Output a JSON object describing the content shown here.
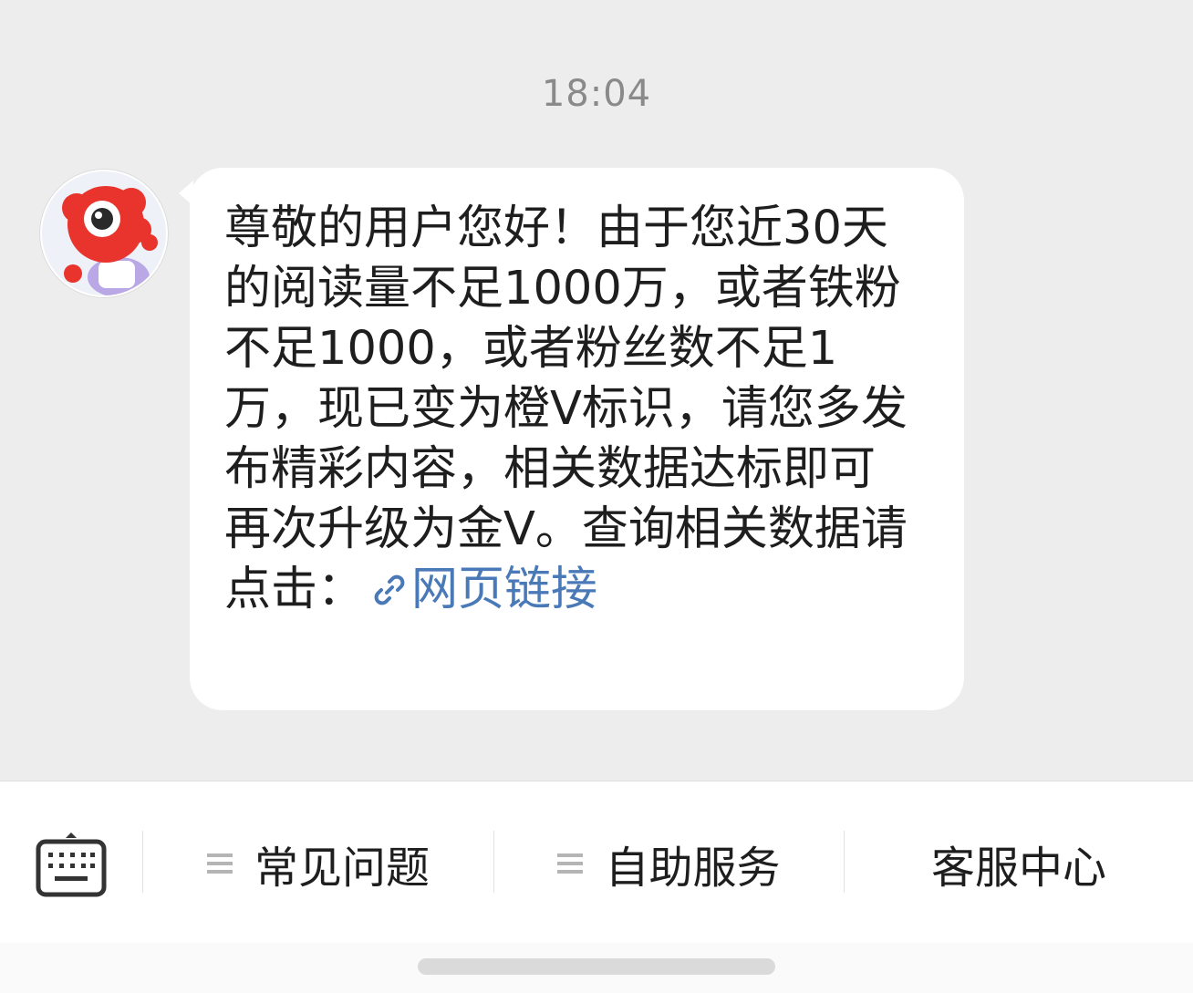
{
  "chat": {
    "timestamp": "18:04",
    "message": {
      "text": "尊敬的用户您好！由于您近30天的阅读量不足1000万，或者铁粉不足1000，或者粉丝数不足1万，现已变为橙V标识，请您多发布精彩内容，相关数据达标即可再次升级为金V。查询相关数据请点击：",
      "link_label": "网页链接",
      "link_icon": "link-icon",
      "link_color": "#4a79b8"
    },
    "avatar": {
      "icon": "weibo-mascot-icon"
    }
  },
  "bottom_menu": {
    "keyboard_icon": "keyboard-icon",
    "items": [
      {
        "label": "常见问题",
        "icon": "menu-lines-icon"
      },
      {
        "label": "自助服务",
        "icon": "menu-lines-icon"
      },
      {
        "label": "客服中心"
      }
    ]
  }
}
